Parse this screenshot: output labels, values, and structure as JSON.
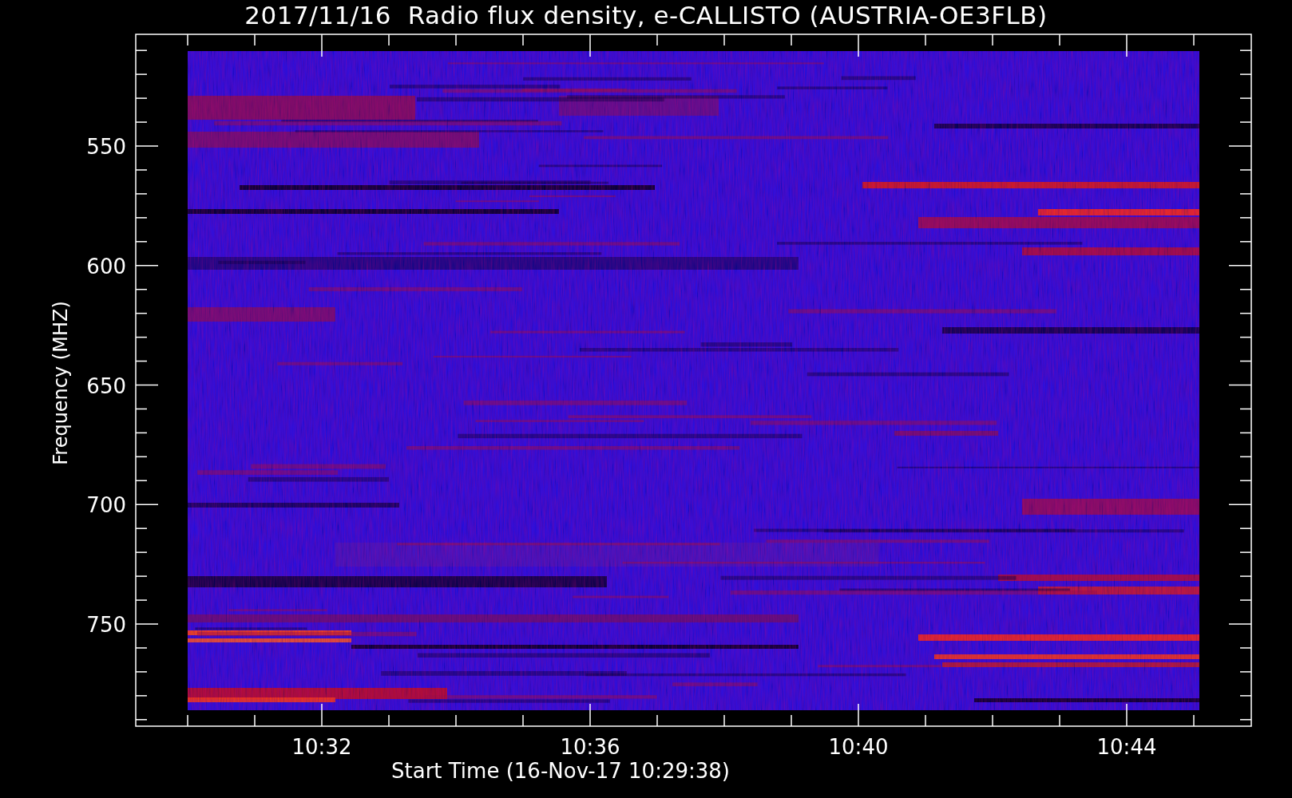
{
  "title": "2017/11/16  Radio flux density, e-CALLISTO (AUSTRIA-OE3FLB)",
  "plot": {
    "ylabel": "Frequency (MHZ)",
    "xlabel": "Start Time (16-Nov-17 10:29:38)",
    "yticks": [
      "550",
      "600",
      "650",
      "700",
      "750"
    ],
    "xticks": [
      "10:32",
      "10:36",
      "10:40",
      "10:44"
    ]
  }
}
